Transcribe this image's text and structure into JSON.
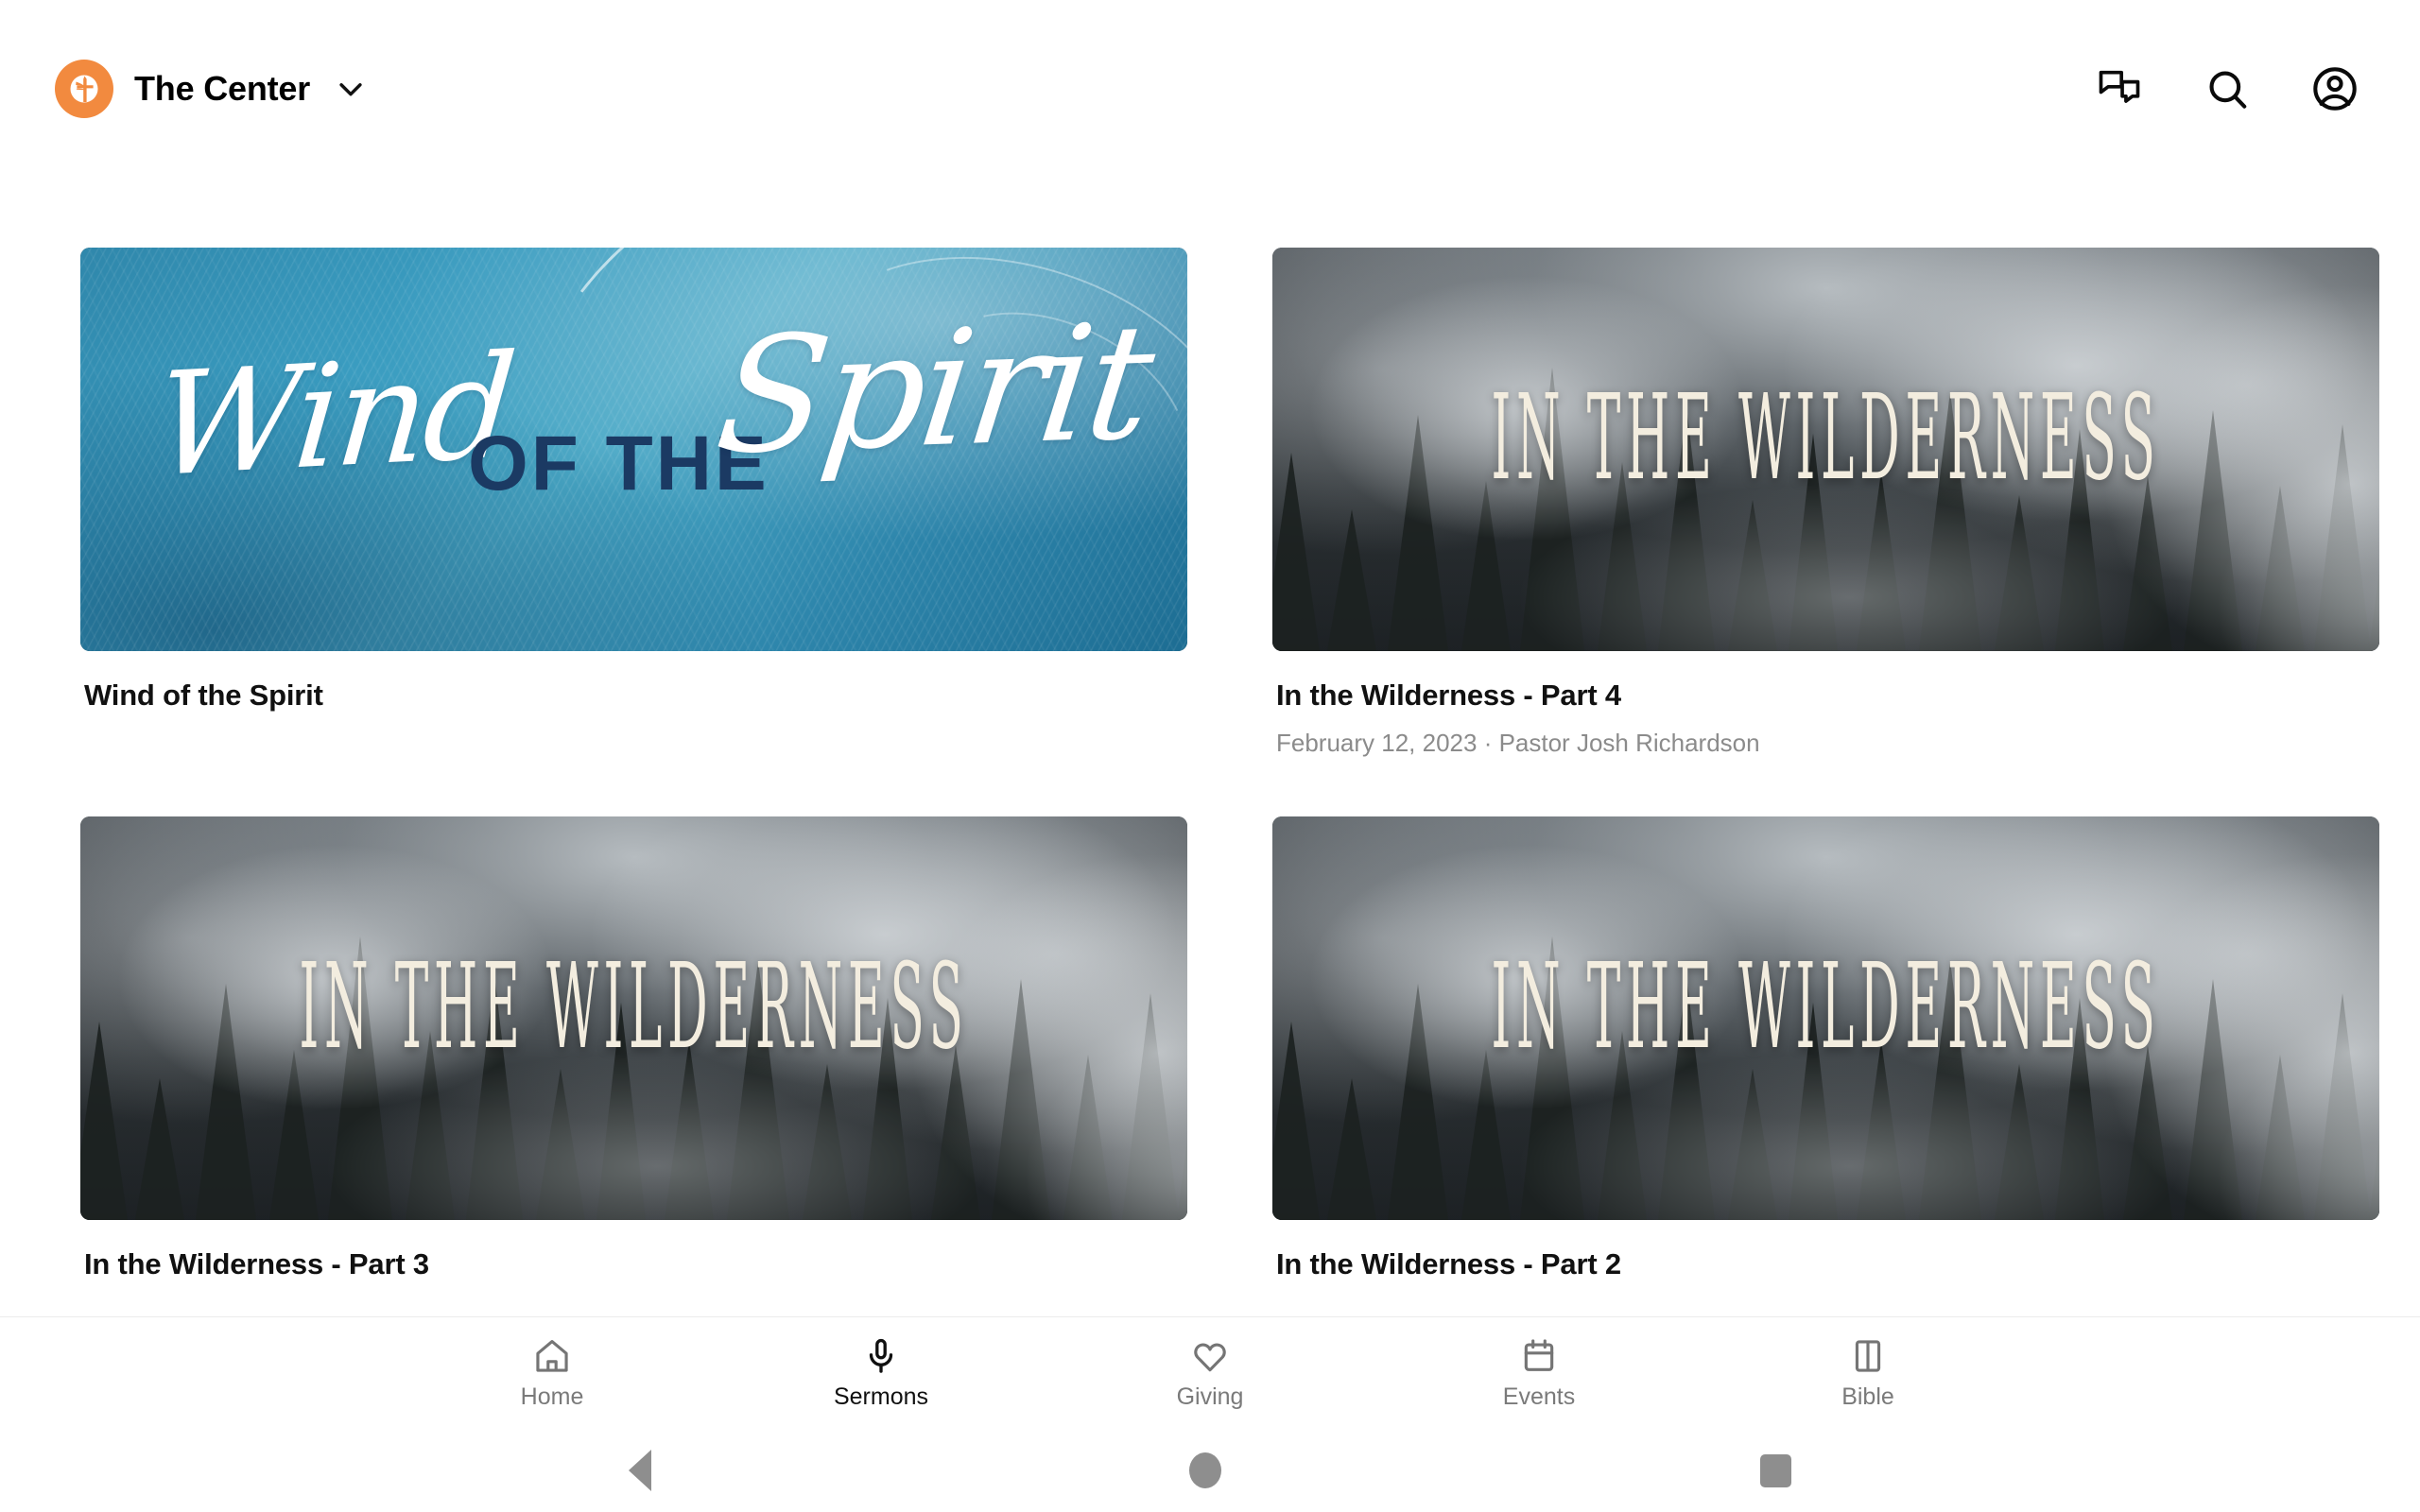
{
  "header": {
    "brand_name": "The Center",
    "logo_icon": "church-cross-logo-icon",
    "logo_color": "#F28A3F",
    "chevron_icon": "chevron-down-icon",
    "actions": [
      {
        "icon": "chat-bubbles-icon",
        "name": "messages-button"
      },
      {
        "icon": "search-icon",
        "name": "search-button"
      },
      {
        "icon": "account-circle-icon",
        "name": "account-button"
      }
    ]
  },
  "sermons": [
    {
      "title": "Wind of the Spirit",
      "subtitle": "",
      "artwork": "wind-of-the-spirit-artwork",
      "artwork_text": {
        "script_first": "Wind",
        "block": "OF THE",
        "script_second": "Spirit"
      },
      "artwork_colors": {
        "water": "#3a9cc0",
        "block_text": "#1b3a63",
        "script_text": "#ffffff"
      }
    },
    {
      "title": "In the Wilderness - Part 4",
      "subtitle": "February 12, 2023 · Pastor Josh Richardson",
      "artwork": "in-the-wilderness-artwork",
      "artwork_text": {
        "headline": "IN THE WILDERNESS"
      },
      "artwork_colors": {
        "fog": "#d7dbde",
        "forest": "#1b1f22",
        "headline_text": "#f3eddf"
      }
    },
    {
      "title": "In the Wilderness - Part 3",
      "subtitle": "",
      "artwork": "in-the-wilderness-artwork",
      "artwork_text": {
        "headline": "IN THE WILDERNESS"
      },
      "artwork_colors": {
        "fog": "#d7dbde",
        "forest": "#1b1f22",
        "headline_text": "#f3eddf"
      }
    },
    {
      "title": "In the Wilderness - Part 2",
      "subtitle": "",
      "artwork": "in-the-wilderness-artwork",
      "artwork_text": {
        "headline": "IN THE WILDERNESS"
      },
      "artwork_colors": {
        "fog": "#d7dbde",
        "forest": "#1b1f22",
        "headline_text": "#f3eddf"
      }
    }
  ],
  "tabbar": {
    "active": "Sermons",
    "items": [
      {
        "label": "Home",
        "icon": "house-icon",
        "active": false
      },
      {
        "label": "Sermons",
        "icon": "microphone-icon",
        "active": true
      },
      {
        "label": "Giving",
        "icon": "heart-icon",
        "active": false
      },
      {
        "label": "Events",
        "icon": "calendar-icon",
        "active": false
      },
      {
        "label": "Bible",
        "icon": "book-icon",
        "active": false
      }
    ]
  },
  "system_nav": {
    "back": "back-triangle-icon",
    "home": "home-circle-icon",
    "recents": "recents-square-icon"
  }
}
